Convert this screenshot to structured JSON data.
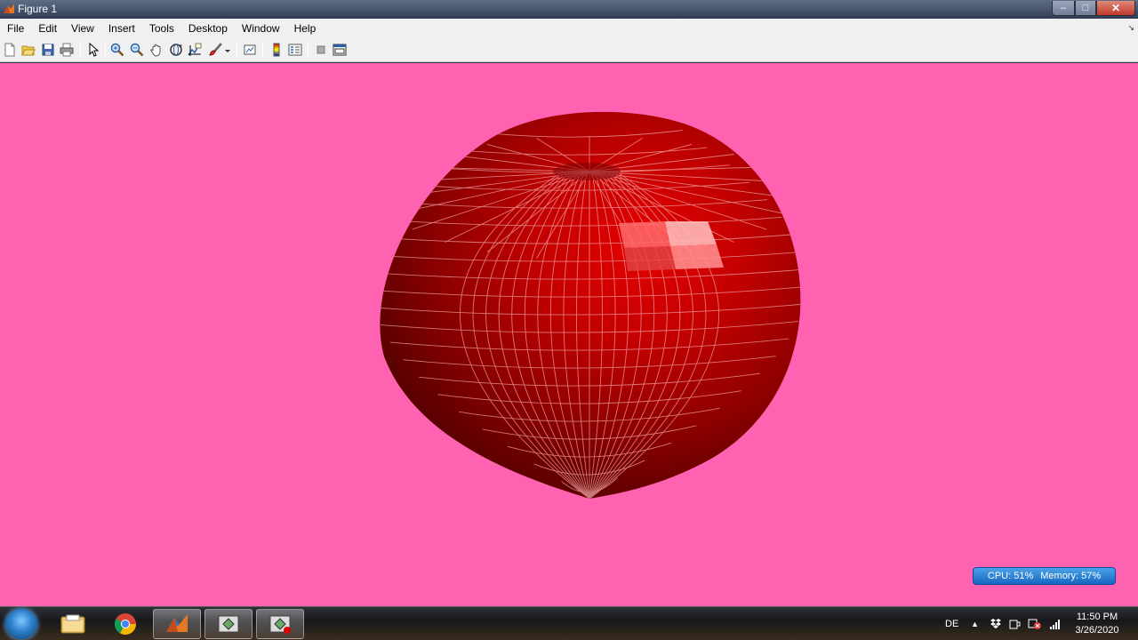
{
  "window": {
    "title": "Figure 1",
    "controls": {
      "minimize": "–",
      "maximize": "□",
      "close": "✕"
    }
  },
  "menubar": {
    "items": [
      "File",
      "Edit",
      "View",
      "Insert",
      "Tools",
      "Desktop",
      "Window",
      "Help"
    ]
  },
  "toolbar": {
    "buttons": [
      "new-figure-icon",
      "open-file-icon",
      "save-icon",
      "print-icon",
      "edit-plot-icon",
      "zoom-in-icon",
      "zoom-out-icon",
      "pan-icon",
      "rotate-3d-icon",
      "data-cursor-icon",
      "brush-icon",
      "link-plot-icon",
      "insert-colorbar-icon",
      "insert-legend-icon",
      "hide-plot-tools-icon",
      "show-plot-tools-icon"
    ]
  },
  "figure": {
    "background_color": "#ff62b0",
    "surface_color": "#b00000",
    "mesh_color": "#f0a0a0"
  },
  "overlay": {
    "cpu": "CPU: 51%",
    "memory": "Memory: 57%"
  },
  "taskbar": {
    "apps": [
      "start-orb-icon",
      "file-explorer-icon",
      "chrome-icon",
      "matlab-icon",
      "app-window-icon",
      "app-window-record-icon"
    ],
    "language": "DE",
    "time": "11:50 PM",
    "date": "3/26/2020"
  }
}
